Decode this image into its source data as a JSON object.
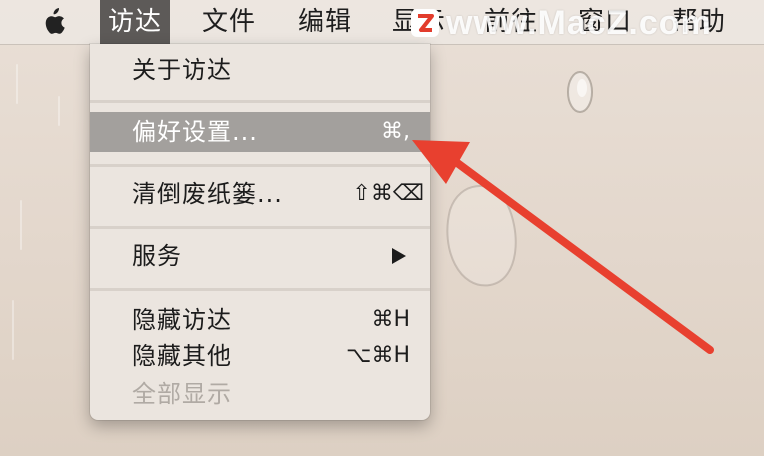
{
  "menubar": {
    "apple_icon": "apple-logo-icon",
    "items": [
      {
        "label": "访达",
        "active": true
      },
      {
        "label": "文件"
      },
      {
        "label": "编辑"
      },
      {
        "label": "显示"
      },
      {
        "label": "前往"
      },
      {
        "label": "窗口"
      },
      {
        "label": "帮助"
      }
    ],
    "watermark": "www.MacZ.com"
  },
  "dropdown": {
    "items": [
      {
        "label": "关于访达",
        "shortcut": ""
      },
      {
        "label": "偏好设置...",
        "shortcut": "⌘,",
        "highlighted": true
      },
      {
        "label": "清倒废纸篓...",
        "shortcut": "⇧⌘⌫"
      },
      {
        "label": "服务",
        "submenu": true
      },
      {
        "label": "隐藏访达",
        "shortcut": "⌘H"
      },
      {
        "label": "隐藏其他",
        "shortcut": "⌥⌘H"
      },
      {
        "label": "全部显示",
        "disabled": true
      }
    ]
  },
  "annotation": {
    "color": "#e8402f",
    "icon": "red-pointer-arrow"
  },
  "colors": {
    "menu_highlight": "#a3a09d",
    "active_menu": "#5d5a58"
  }
}
